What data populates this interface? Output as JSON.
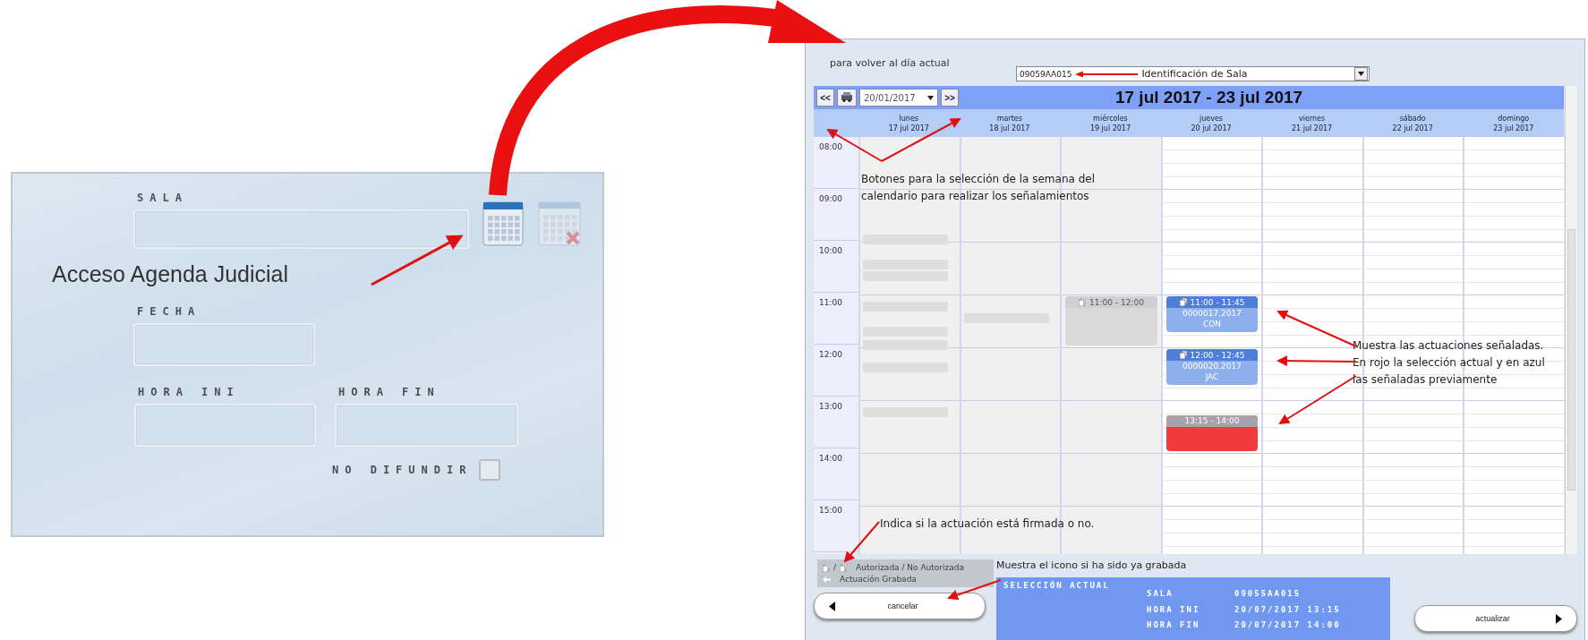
{
  "form_panel": {
    "sala": {
      "label": "SALA"
    },
    "note": "Acceso Agenda Judicial",
    "fecha": {
      "label": "FECHA"
    },
    "hora_ini": {
      "label": "HORA INI"
    },
    "hora_fin": {
      "label": "HORA FIN"
    },
    "no_difundir": {
      "label": "NO DIFUNDIR",
      "checked": false
    }
  },
  "calendar_window": {
    "top_note": "para volver al día actual",
    "sala_select": {
      "value": "09059AA015"
    },
    "sala_note": "Identificación de Sala",
    "prev_button": "<<",
    "next_button": ">>",
    "date_field": "20/01/2017",
    "title": "17 jul 2017 - 23 jul 2017",
    "days": [
      {
        "name": "lunes",
        "date": "17 jul 2017",
        "past": true
      },
      {
        "name": "martes",
        "date": "18 jul 2017",
        "past": true
      },
      {
        "name": "miércoles",
        "date": "19 jul 2017",
        "past": true,
        "events": [
          {
            "kind": "past",
            "time": "11:00 - 12:00"
          }
        ]
      },
      {
        "name": "jueves",
        "date": "20 jul 2017",
        "past": false,
        "events": [
          {
            "kind": "previous",
            "time": "11:00 - 11:45",
            "case": "0000017.2017",
            "code": "CON"
          },
          {
            "kind": "previous",
            "time": "12:00 - 12:45",
            "case": "0000020.2017",
            "code": "JAC"
          },
          {
            "kind": "selected",
            "time": "13:15 - 14:00"
          }
        ]
      },
      {
        "name": "viernes",
        "date": "21 jul 2017",
        "past": false
      },
      {
        "name": "sábado",
        "date": "22 jul 2017",
        "past": false
      },
      {
        "name": "domingo",
        "date": "23 jul 2017",
        "past": false
      }
    ],
    "hours": [
      "08:00",
      "09:00",
      "10:00",
      "11:00",
      "12:00",
      "13:00",
      "14:00",
      "15:00"
    ],
    "week_note": "Botones para la selección de la semana del calendario para realizar los señalamientos",
    "events_note": "Muestra las actuaciones señaladas. En rojo la selección actual y en azul las señaladas previamente",
    "signed_note": "Indica si la actuación está firmada o no.",
    "legend": [
      {
        "kind": "pair",
        "separator": "/",
        "label": "Autorizada / No Autorizada"
      },
      {
        "kind": "single",
        "label": "Actuación Grabada"
      }
    ],
    "saved_note": "Muestra el icono si ha sido ya grabada",
    "selection": {
      "title": "SELECCIÓN ACTUAL",
      "rows": [
        {
          "label": "SALA",
          "value": "09055AA015"
        },
        {
          "label": "HORA INI",
          "value": "20/07/2017 13:15"
        },
        {
          "label": "HORA FIN",
          "value": "20/07/2017 14:00"
        }
      ]
    },
    "cancel_button": "cancelar",
    "update_button": "actualizar"
  }
}
